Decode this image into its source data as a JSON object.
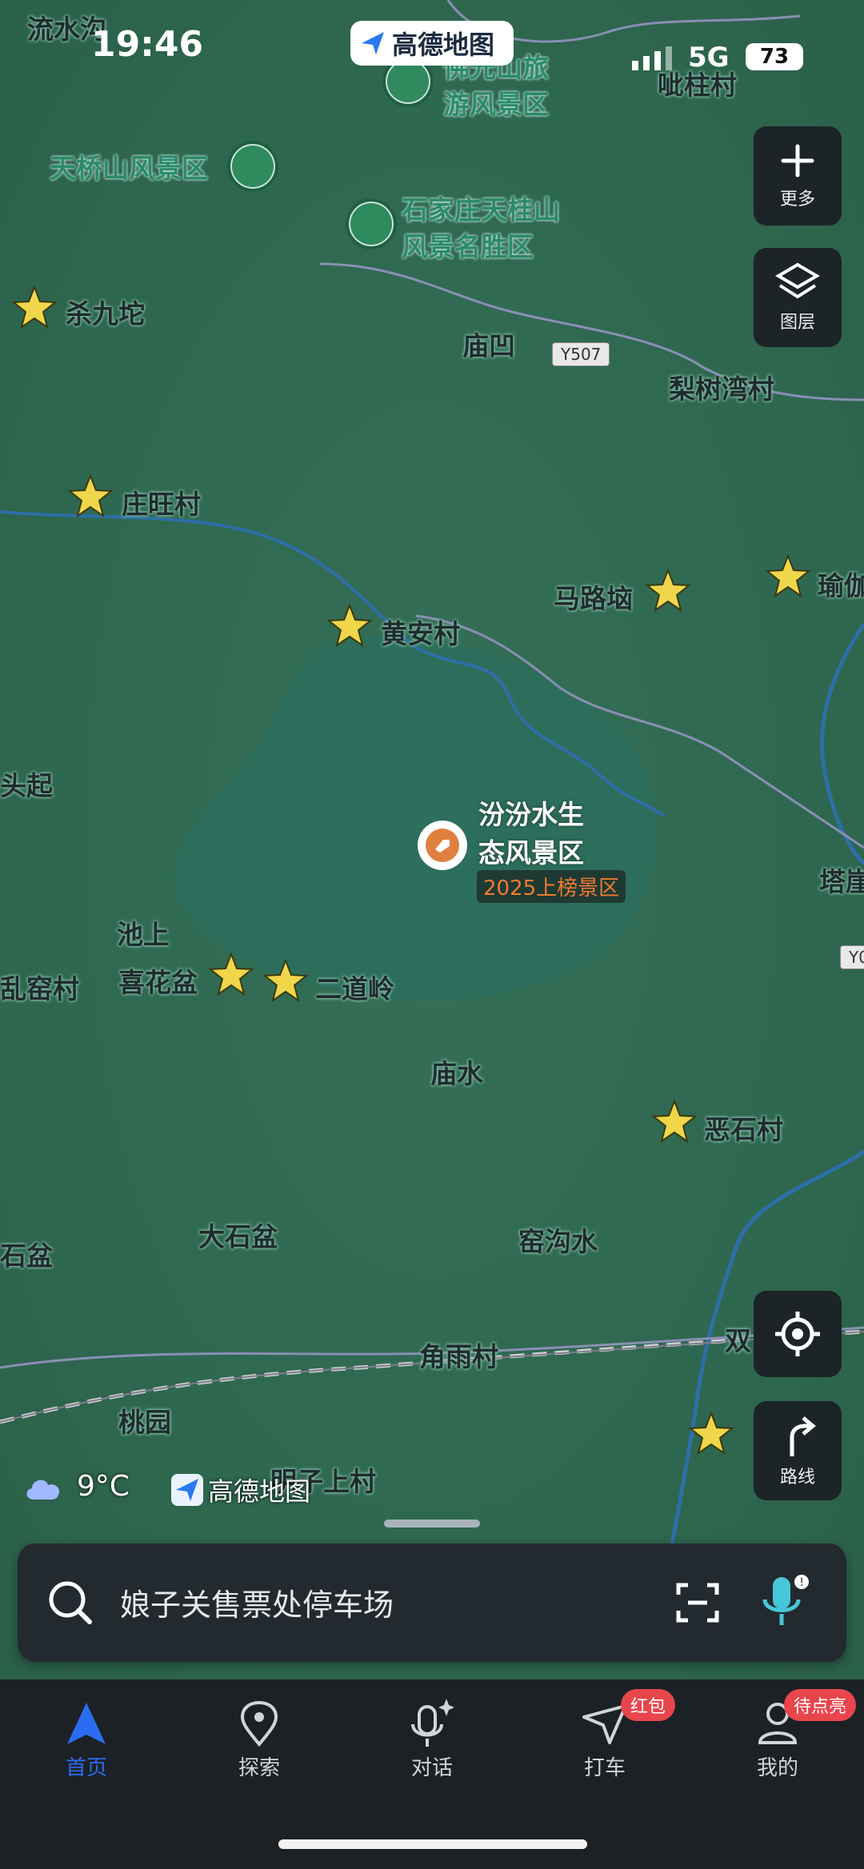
{
  "status_bar": {
    "time": "19:46",
    "network": "5G",
    "battery": "73"
  },
  "top_badge": {
    "label": "高德地图"
  },
  "controls": {
    "more_label": "更多",
    "layers_label": "图层",
    "route_label": "路线"
  },
  "map": {
    "place_labels": [
      "流水沟",
      "佛光山旅",
      "游风景区",
      "呲柱村",
      "天桥山风景区",
      "石家庄天桂山",
      "风景名胜区",
      "杀九坨",
      "庙凹",
      "Y507",
      "梨树湾村",
      "庄旺村",
      "马路垴",
      "瑜伽",
      "黄安村",
      "头起",
      "汾汾水生",
      "态风景区",
      "2025上榜景区",
      "塔崖",
      "池上",
      "喜花盆",
      "二道岭",
      "乱窑村",
      "Y0",
      "庙水",
      "恶石村",
      "大石盆",
      "窑沟水",
      "石盆",
      "角雨村",
      "双",
      "桃园",
      "明子上村"
    ],
    "weather": {
      "temp": "9°C"
    },
    "watermark": "高德地图"
  },
  "search": {
    "placeholder": "娘子关售票处停车场"
  },
  "tabs": [
    {
      "label": "首页",
      "icon": "home-arrow-icon",
      "active": true
    },
    {
      "label": "探索",
      "icon": "location-pin-icon"
    },
    {
      "label": "对话",
      "icon": "microphone-sparkle-icon"
    },
    {
      "label": "打车",
      "icon": "taxi-arrow-icon",
      "badge": "红包"
    },
    {
      "label": "我的",
      "icon": "user-icon",
      "badge": "待点亮"
    }
  ],
  "colors": {
    "accent": "#2a6cf0",
    "map_bg": "#2f6850",
    "badge_red": "#e9454c"
  }
}
